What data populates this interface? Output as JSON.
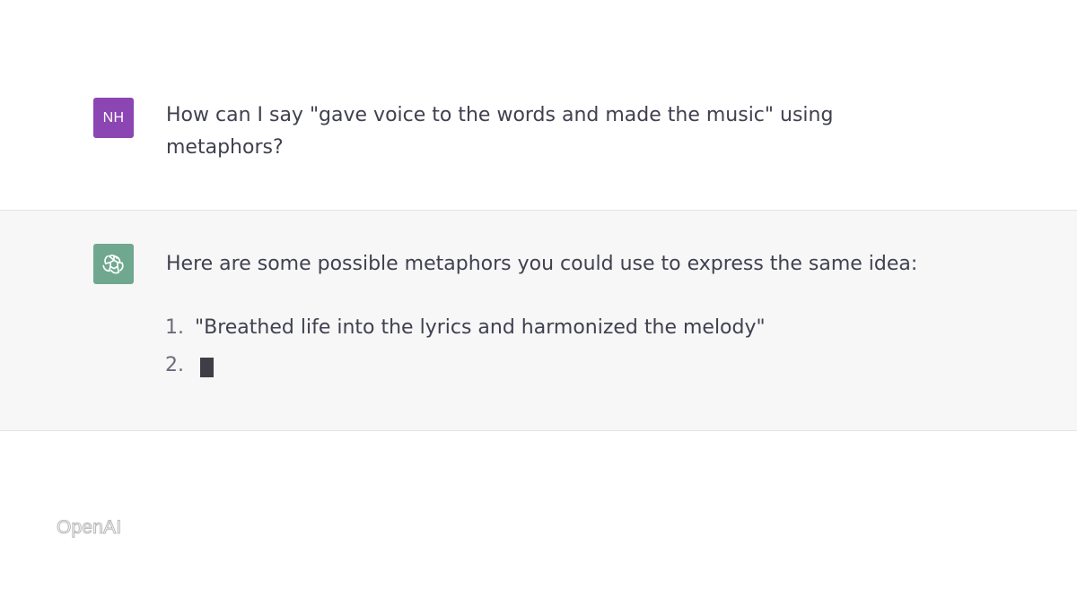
{
  "conversation": {
    "user": {
      "avatar_initials": "NH",
      "avatar_color": "#8c46b4",
      "message": "How can I say \"gave voice to the words and made the music\" using metaphors?"
    },
    "assistant": {
      "avatar_icon": "openai-logo-icon",
      "avatar_color": "#6fa88f",
      "intro": "Here are some possible metaphors you could use to express the same idea:",
      "list": [
        {
          "number": "1.",
          "text": "\"Breathed life into the lyrics and harmonized the melody\""
        },
        {
          "number": "2.",
          "text": ""
        }
      ],
      "typing_cursor": "streaming-cursor"
    }
  },
  "watermark": {
    "text": "OpenAI"
  }
}
